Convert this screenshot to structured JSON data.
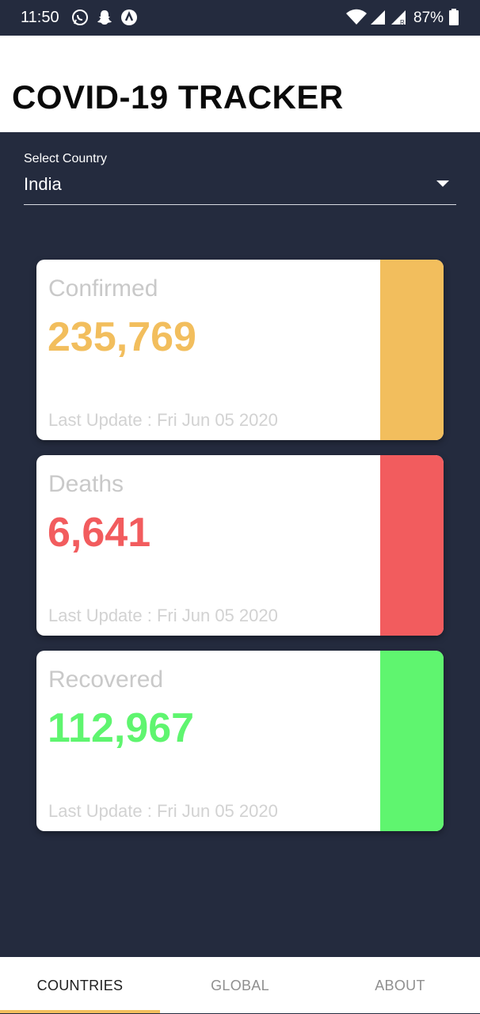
{
  "status_bar": {
    "time": "11:50",
    "battery_percent": "87%",
    "icons": [
      "whatsapp-icon",
      "snapchat-icon",
      "app-a-icon",
      "wifi-icon",
      "signal-icon",
      "signal-roaming-icon",
      "battery-icon"
    ]
  },
  "header": {
    "title": "COVID-19 TRACKER"
  },
  "country_select": {
    "label": "Select Country",
    "value": "India"
  },
  "cards": [
    {
      "title": "Confirmed",
      "value": "235,769",
      "last_update": "Last Update : Fri Jun 05 2020",
      "color": "#f2be5d"
    },
    {
      "title": "Deaths",
      "value": "6,641",
      "last_update": "Last Update : Fri Jun 05 2020",
      "color": "#f25c5e"
    },
    {
      "title": "Recovered",
      "value": "112,967",
      "last_update": "Last Update : Fri Jun 05 2020",
      "color": "#5ff56f"
    }
  ],
  "bottom_nav": {
    "tabs": [
      {
        "label": "COUNTRIES",
        "active": true
      },
      {
        "label": "GLOBAL",
        "active": false
      },
      {
        "label": "ABOUT",
        "active": false
      }
    ],
    "indicator_color": "#f2be5d"
  },
  "colors": {
    "background": "#242b3e",
    "header_bg": "#ffffff",
    "confirmed": "#f2be5d",
    "deaths": "#f25c5e",
    "recovered": "#5ff56f"
  }
}
